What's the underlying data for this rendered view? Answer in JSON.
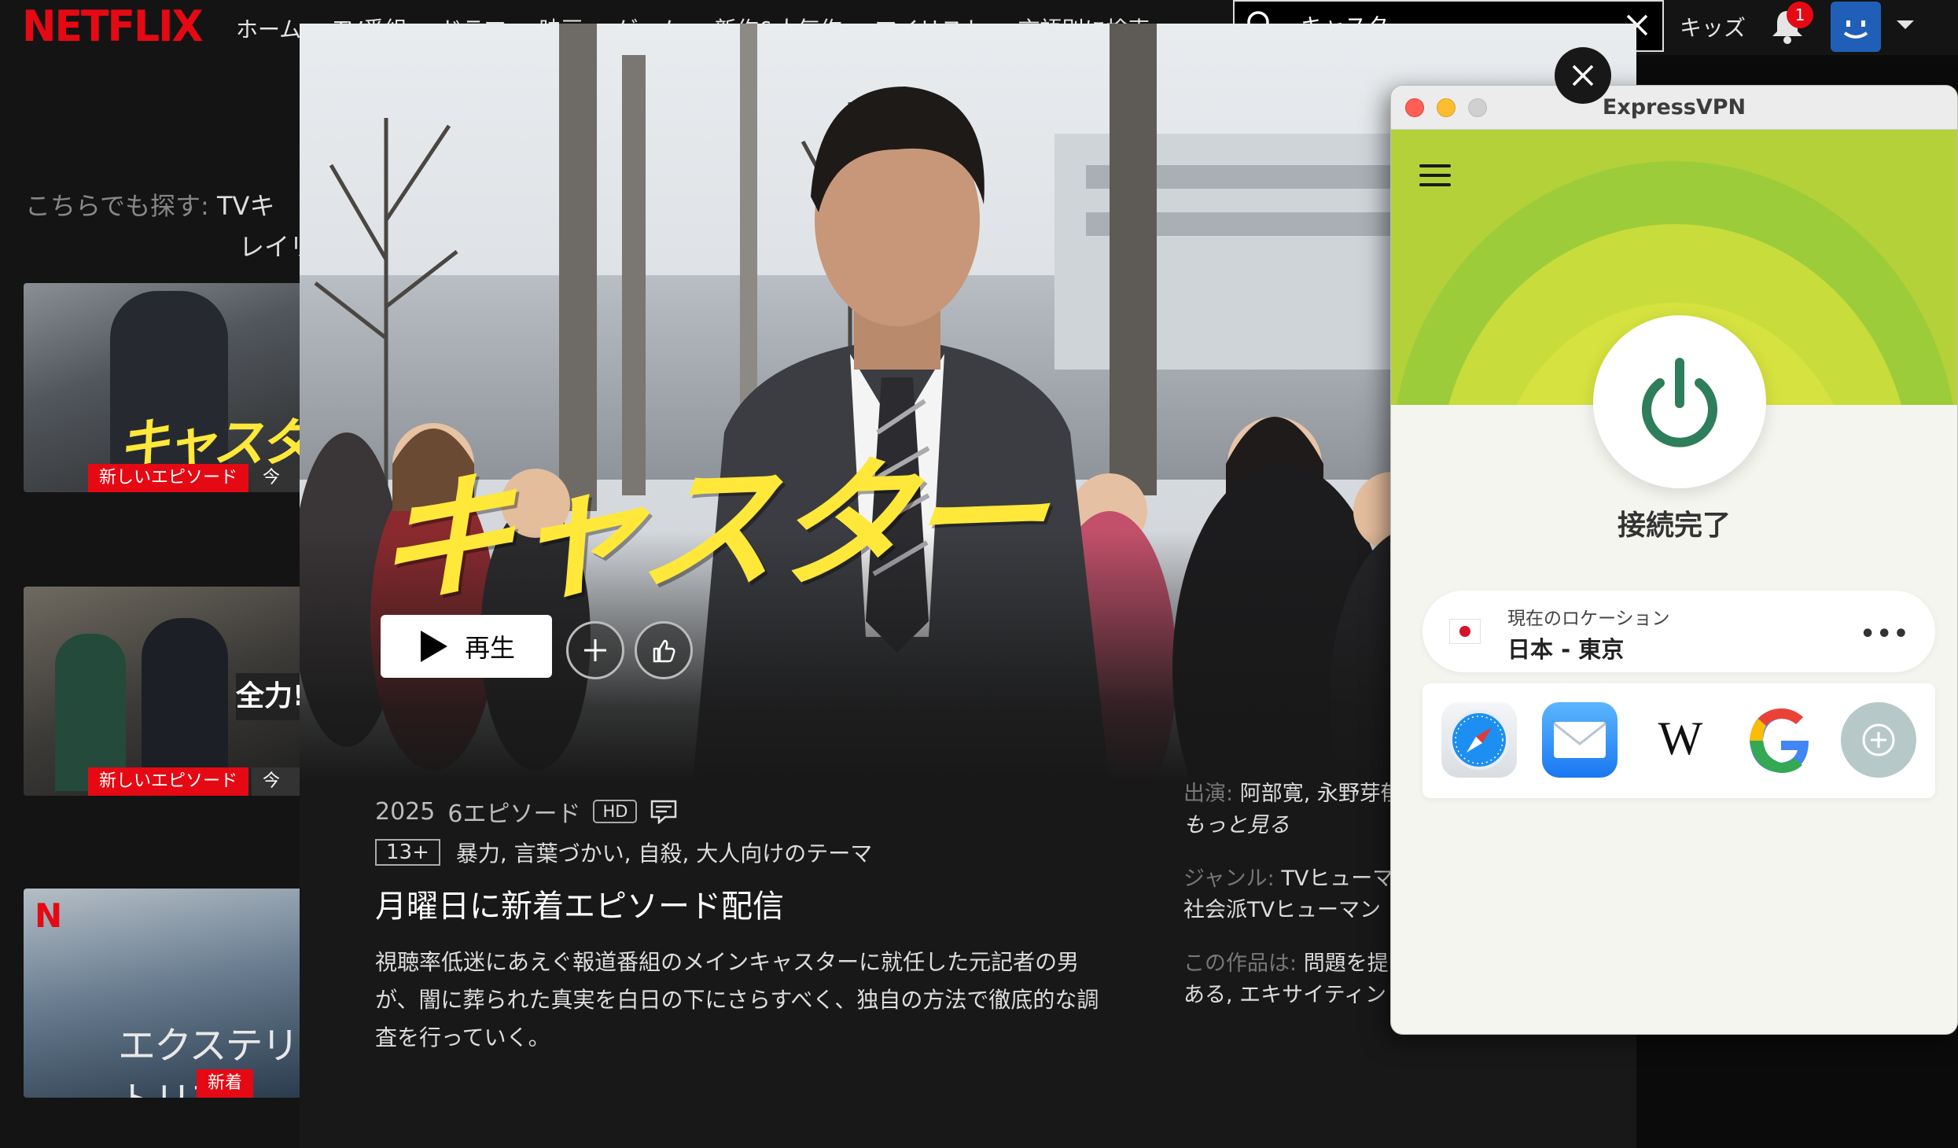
{
  "netflix": {
    "logo": "NETFLIX",
    "nav": [
      "ホーム",
      "TV番組",
      "ドラマ",
      "映画",
      "ゲーム",
      "新作&人気作",
      "マイリスト",
      "言語別に検索"
    ],
    "search_value": "キャスター",
    "kids": "キッズ",
    "notification_count": "1",
    "explore_label": "こちらでも探す:",
    "explore_line1": "TVキ",
    "explore_line2": "レイリ",
    "rows": [
      {
        "tag1": "新しいエピソード",
        "tag2": "今すぐ"
      },
      {
        "tag1": "新しいエピソード",
        "tag2": "今すぐ"
      },
      {
        "tag1": "新着"
      }
    ]
  },
  "modal": {
    "title": "キャスター",
    "play_label": "再生",
    "year": "2025",
    "episodes": "6エピソード",
    "quality": "HD",
    "age_rating": "13+",
    "content_warnings": "暴力, 言葉づかい, 自殺, 大人向けのテーマ",
    "tagline": "月曜日に新着エピソード配信",
    "synopsis": "視聴率低迷にあえぐ報道番組のメインキャスターに就任した元記者の男が、闇に葬られた真実を白日の下にさらすべく、独自の方法で徹底的な調査を行っていく。",
    "cast_label": "出演:",
    "cast_value": "阿部寛, 永野芽郁",
    "more": "もっと見る",
    "genre_label": "ジャンル:",
    "genre_value": "TVヒューマ",
    "genre_line2": "社会派TVヒューマン",
    "mood_label": "この作品は:",
    "mood_value": "問題を提",
    "mood_line2": "ある, エキサイティン"
  },
  "vpn": {
    "window_title": "ExpressVPN",
    "status": "接続完了",
    "location_label": "現在のロケーション",
    "location_value": "日本 - 東京",
    "accent": "#b4d13a",
    "power_color": "#2e7d5b",
    "shortcuts": [
      "safari-icon",
      "mail-icon",
      "wikipedia-icon",
      "google-icon",
      "add-shortcut-icon"
    ]
  }
}
